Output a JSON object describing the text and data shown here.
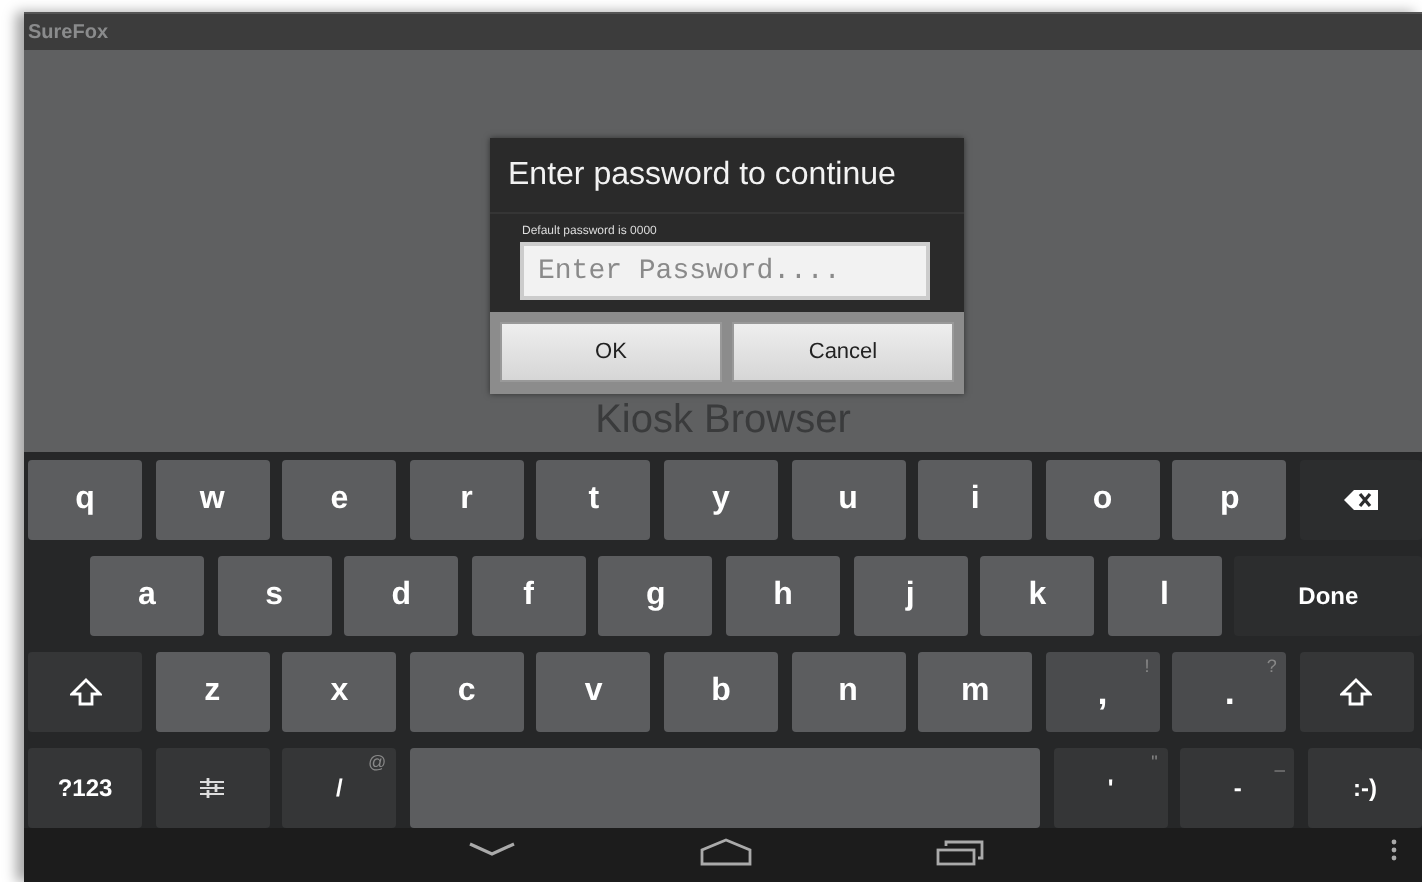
{
  "window": {
    "title": "SureFox"
  },
  "background_text": "Kiosk Browser",
  "dialog": {
    "title": "Enter password to continue",
    "hint": "Default password is 0000",
    "field": {
      "placeholder": "Enter Password...."
    },
    "buttons": [
      "OK",
      "Cancel"
    ]
  },
  "keyboard": {
    "rows": [
      {
        "keys": [
          {
            "kind": "char",
            "label": "q"
          },
          {
            "kind": "char",
            "label": "w"
          },
          {
            "kind": "char",
            "label": "e"
          },
          {
            "kind": "char",
            "label": "r"
          },
          {
            "kind": "char",
            "label": "t"
          },
          {
            "kind": "char",
            "label": "y"
          },
          {
            "kind": "char",
            "label": "u"
          },
          {
            "kind": "char",
            "label": "i"
          },
          {
            "kind": "char",
            "label": "o"
          },
          {
            "kind": "char",
            "label": "p"
          },
          {
            "kind": "backspace"
          }
        ]
      },
      {
        "keys": [
          {
            "kind": "char",
            "label": "a"
          },
          {
            "kind": "char",
            "label": "s"
          },
          {
            "kind": "char",
            "label": "d"
          },
          {
            "kind": "char",
            "label": "f"
          },
          {
            "kind": "char",
            "label": "g"
          },
          {
            "kind": "char",
            "label": "h"
          },
          {
            "kind": "char",
            "label": "j"
          },
          {
            "kind": "char",
            "label": "k"
          },
          {
            "kind": "char",
            "label": "l"
          },
          {
            "kind": "action",
            "label": "Done"
          }
        ]
      },
      {
        "keys": [
          {
            "kind": "shift"
          },
          {
            "kind": "char",
            "label": "z"
          },
          {
            "kind": "char",
            "label": "x"
          },
          {
            "kind": "char",
            "label": "c"
          },
          {
            "kind": "char",
            "label": "v"
          },
          {
            "kind": "char",
            "label": "b"
          },
          {
            "kind": "char",
            "label": "n"
          },
          {
            "kind": "char",
            "label": "m"
          },
          {
            "kind": "punct",
            "label": ",",
            "hint": "!"
          },
          {
            "kind": "punct",
            "label": ".",
            "hint": "?"
          },
          {
            "kind": "shift"
          }
        ]
      },
      {
        "keys": [
          {
            "kind": "function",
            "label": "?123"
          },
          {
            "kind": "settings"
          },
          {
            "kind": "function",
            "label": "/",
            "hint": "@"
          },
          {
            "kind": "space"
          },
          {
            "kind": "function",
            "label": "'",
            "hint": "\""
          },
          {
            "kind": "function",
            "label": "-",
            "hint": "_"
          },
          {
            "kind": "function",
            "label": ":-)"
          }
        ]
      }
    ]
  },
  "nav_bar": {
    "buttons": [
      {
        "kind": "back"
      },
      {
        "kind": "home"
      },
      {
        "kind": "recents"
      },
      {
        "kind": "menu"
      }
    ]
  }
}
